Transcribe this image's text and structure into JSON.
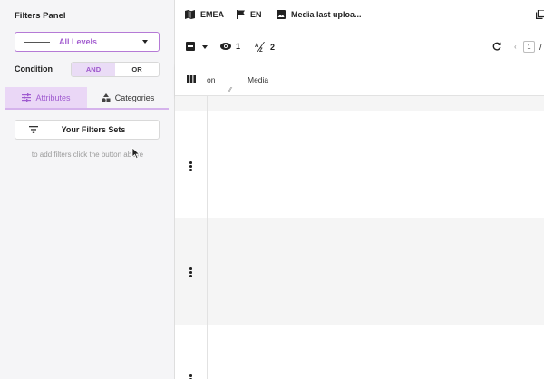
{
  "panel": {
    "title": "Filters Panel",
    "level_select": {
      "value": "All Levels"
    },
    "condition": {
      "label": "Condition",
      "options": [
        "AND",
        "OR"
      ],
      "selected": "AND"
    },
    "tabs": [
      {
        "label": "Attributes",
        "icon": "tune-icon",
        "active": true
      },
      {
        "label": "Categories",
        "icon": "shapes-icon",
        "active": false
      }
    ],
    "filter_sets_button": {
      "label": "Your Filters Sets",
      "icon": "filter-list-icon"
    },
    "hint": "to add filters click the button above"
  },
  "topbar": {
    "region": {
      "label": "EMEA",
      "icon": "map-icon"
    },
    "language": {
      "label": "EN",
      "icon": "flag-icon"
    },
    "media": {
      "label": "Media last uploa...",
      "icon": "image-icon"
    },
    "overflow_icon": "library-icon"
  },
  "actionbar": {
    "visible_count": "1",
    "sort_count": "2",
    "page_input": "1",
    "page_separator": "/"
  },
  "columns": {
    "icon": "columns-icon",
    "headers": [
      "on",
      "Media"
    ]
  },
  "colors": {
    "accent": "#a45fd0",
    "accent_light": "#ead7f6",
    "panel_bg": "#f5f5f7",
    "row_shade": "#f5f5f5"
  }
}
